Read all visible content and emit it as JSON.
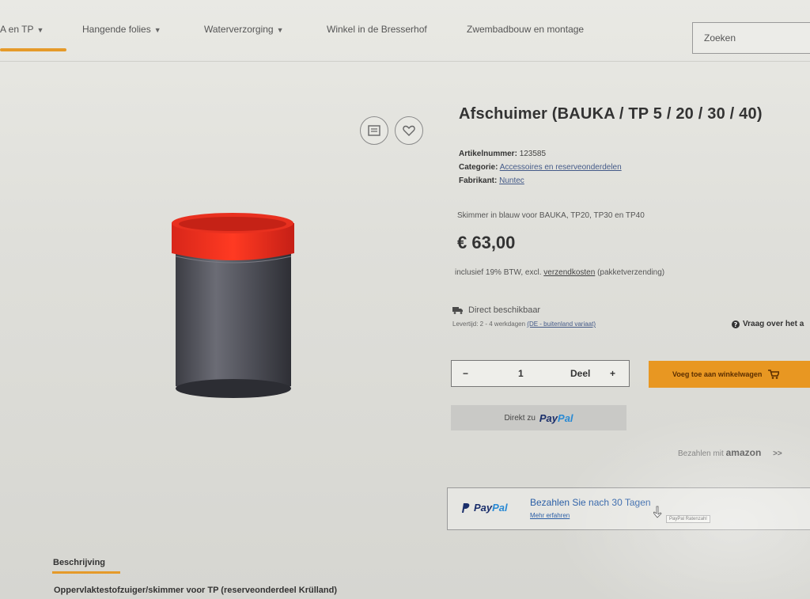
{
  "nav": {
    "items": [
      {
        "label": "A en TP",
        "chevron": true
      },
      {
        "label": "Hangende folies",
        "chevron": true
      },
      {
        "label": "Waterverzorging",
        "chevron": true
      },
      {
        "label": "Winkel in de Bresserhof",
        "chevron": false
      },
      {
        "label": "Zwembadbouw en montage",
        "chevron": false
      }
    ],
    "search_placeholder": "Zoeken",
    "accent_color": "#e59a2a"
  },
  "gallery": {
    "icons": [
      "gallery-icon",
      "heart-icon"
    ]
  },
  "product": {
    "title": "Afschuimer (BAUKA / TP 5 / 20 / 30 / 40)",
    "sku_label": "Artikelnummer:",
    "sku_value": "123585",
    "category_label": "Categorie:",
    "category_value": "Accessoires en reserveonderdelen",
    "manufacturer_label": "Fabrikant:",
    "manufacturer_value": "Nuntec",
    "short_description": "Skimmer in blauw voor BAUKA, TP20, TP30 en TP40",
    "price": "€ 63,00",
    "tax_text": "inclusief 19% BTW, excl.",
    "tax_link": "verzendkosten",
    "tax_suffix": "(pakketverzending)",
    "availability": "Direct beschikbaar",
    "delivery_text": "Levertijd: 2 - 4 werkdagen",
    "delivery_link": "(DE - buitenland variaat)",
    "question_link": "Vraag over het a"
  },
  "purchase": {
    "minus": "−",
    "quantity": "1",
    "unit": "Deel",
    "plus": "+",
    "add_to_cart": "Voeg toe aan winkelwagen",
    "cart_color": "#e89722",
    "paypal_prefix": "Direkt zu",
    "paypal_pay": "Pay",
    "paypal_pal": "Pal",
    "amazon_prefix": "Bezahlen mit",
    "amazon_brand": "amazon",
    "amazon_arrow": ">>"
  },
  "paylater": {
    "logo_pay": "Pay",
    "logo_pal": "Pal",
    "headline": "Bezahlen Sie nach 30 Tagen",
    "more": "Mehr erfahren",
    "tooltip": "PayPal Ratenzahl"
  },
  "description": {
    "tab_label": "Beschrijving",
    "first_line": "Oppervlaktestofzuiger/skimmer voor TP (reserveonderdeel Krülland)"
  }
}
